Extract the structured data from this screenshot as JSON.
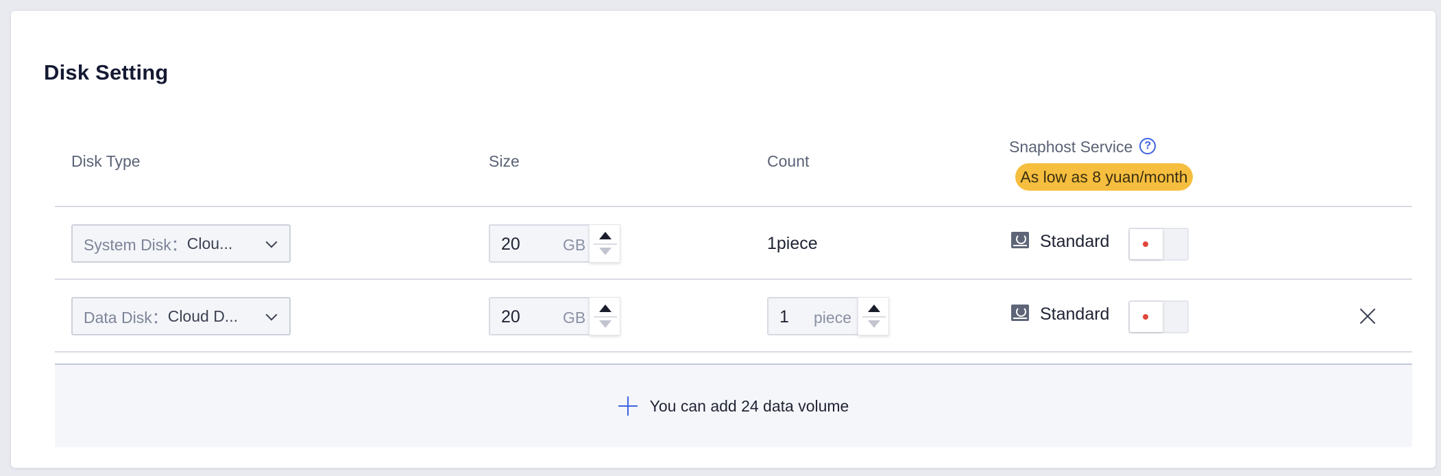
{
  "title": "Disk Setting",
  "columns": {
    "disk_type": "Disk Type",
    "size": "Size",
    "count": "Count",
    "snapshot": "Snaphost Service"
  },
  "promo": "As low as 8 yuan/month",
  "icons": {
    "help": "?"
  },
  "rows": [
    {
      "disk_label": "System Disk：",
      "disk_value": "Clou...",
      "size_value": "20",
      "size_unit": "GB",
      "count_text": "1piece",
      "snapshot_label": "Standard"
    },
    {
      "disk_label": "Data Disk：",
      "disk_value": "Cloud D...",
      "size_value": "20",
      "size_unit": "GB",
      "count_value": "1",
      "count_unit": "piece",
      "snapshot_label": "Standard"
    }
  ],
  "add_volume_text": "You can add 24 data volume",
  "colors": {
    "accent": "#3c62e0",
    "promo_bg": "#f6be3e",
    "toggle_dot": "#e0473a"
  }
}
